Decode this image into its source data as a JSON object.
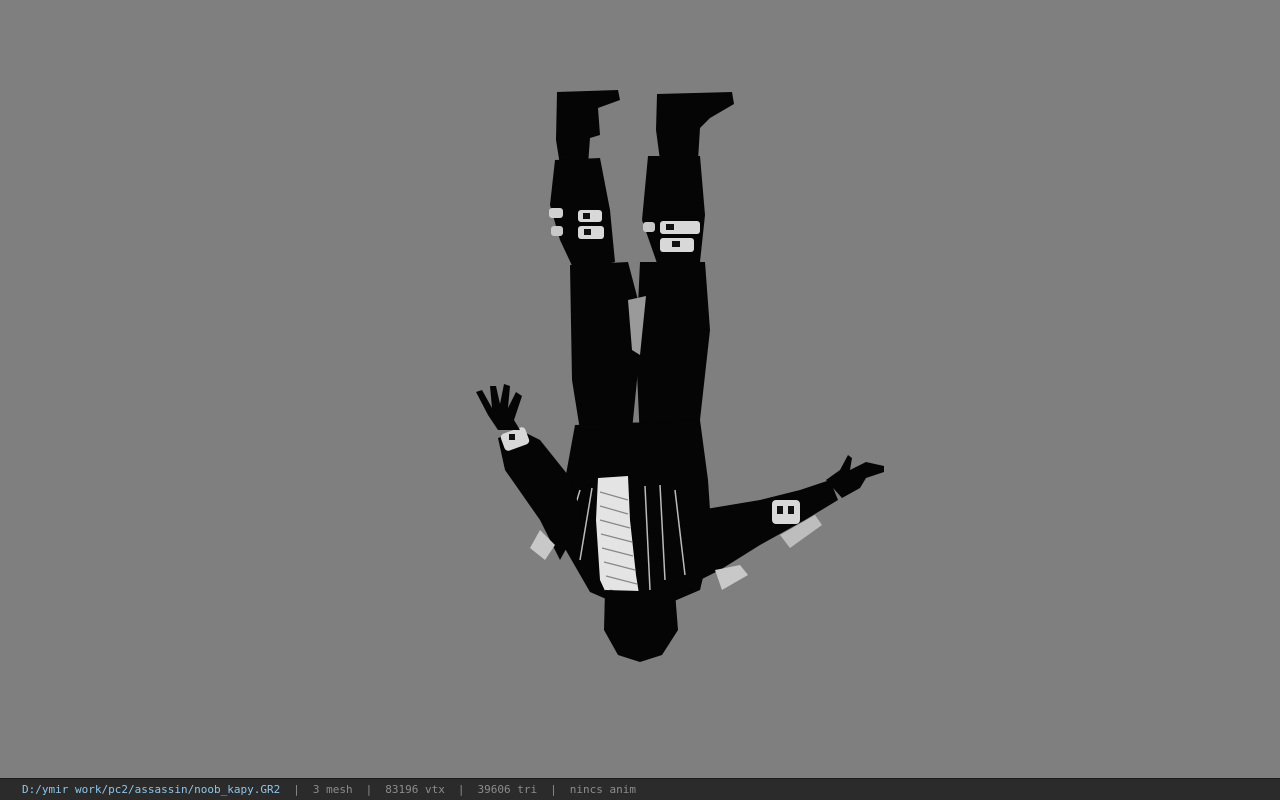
{
  "viewport": {
    "background_color": "#7f7f7f",
    "model": {
      "description_icon": "character-model-icon",
      "body_color": "#050505",
      "armor_color": "#d8d8d8"
    }
  },
  "status_bar": {
    "file_path": "D:/ymir work/pc2/assassin/noob_kapy.GR2",
    "separator": "|",
    "mesh": "3 mesh",
    "vertices": "83196 vtx",
    "triangles": "39606 tri",
    "animation": "nincs anim"
  }
}
